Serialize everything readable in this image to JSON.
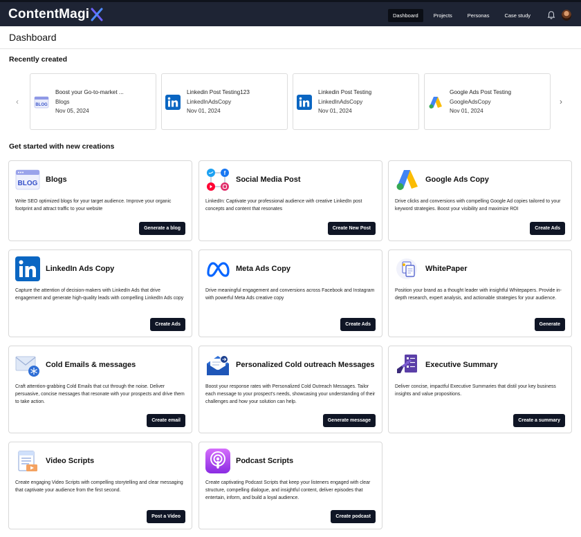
{
  "app": {
    "logo_text": "ContentMagi",
    "logo_mark": "X"
  },
  "nav": {
    "items": [
      {
        "label": "Dashboard",
        "active": true
      },
      {
        "label": "Projects",
        "active": false
      },
      {
        "label": "Personas",
        "active": false
      },
      {
        "label": "Case study",
        "active": false
      }
    ]
  },
  "page": {
    "title": "Dashboard"
  },
  "recent": {
    "title": "Recently created",
    "items": [
      {
        "icon": "blog-icon",
        "title": "Boost your Go-to-market ...",
        "type": "Blogs",
        "date": "Nov 05, 2024"
      },
      {
        "icon": "linkedin-icon",
        "title": "Linkedin Post Testing123",
        "type": "LinkedInAdsCopy",
        "date": "Nov 01, 2024"
      },
      {
        "icon": "linkedin-icon",
        "title": "Linkedin Post Testing",
        "type": "LinkedInAdsCopy",
        "date": "Nov 01, 2024"
      },
      {
        "icon": "google-ads-icon",
        "title": "Google Ads Post Testing",
        "type": "GoogleAdsCopy",
        "date": "Nov 01, 2024"
      }
    ]
  },
  "creations": {
    "title": "Get started with new creations",
    "cards": [
      {
        "icon": "blog-icon",
        "title": "Blogs",
        "description": "Write SEO optimized blogs for your target audience. Improve your organic footprint and attract traffic to your website",
        "button": "Generate a blog"
      },
      {
        "icon": "social-media-icon",
        "title": "Social Media Post",
        "description": "LinkedIn: Captivate your professional audience with creative LinkedIn post concepts and content that resonates",
        "button": "Create New Post"
      },
      {
        "icon": "google-ads-icon",
        "title": "Google Ads Copy",
        "description": "Drive clicks and conversions with compelling Google Ad copies tailored to your keyword strategies. Boost your visibility and maximize ROI",
        "button": "Create Ads"
      },
      {
        "icon": "linkedin-icon",
        "title": "LinkedIn Ads Copy",
        "description": "Capture the attention of decision-makers with LinkedIn Ads that drive engagement and generate high-quality leads with compelling LinkedIn Ads copy",
        "button": "Create Ads"
      },
      {
        "icon": "meta-icon",
        "title": "Meta Ads Copy",
        "description": "Drive meaningful engagement and conversions across Facebook and Instagram with powerful Meta Ads creative copy",
        "button": "Create Ads"
      },
      {
        "icon": "whitepaper-icon",
        "title": "WhitePaper",
        "description": "Position your brand as a thought leader with insightful Whitepapers. Provide in-depth research, expert analysis, and actionable strategies for your audience.",
        "button": "Generate"
      },
      {
        "icon": "email-icon",
        "title": "Cold Emails & messages",
        "description": "Craft attention-grabbing Cold Emails that cut through the noise. Deliver persuasive, concise messages that resonate with your prospects and drive them to take action.",
        "button": "Create email"
      },
      {
        "icon": "outreach-icon",
        "title": "Personalized Cold outreach Messages",
        "description": "Boost your response rates with Personalized Cold Outreach Messages. Tailor each message to your prospect's needs, showcasing your understanding of their challenges and how your solution can help.",
        "button": "Generate message"
      },
      {
        "icon": "executive-summary-icon",
        "title": "Executive Summary",
        "description": "Deliver concise, impactful Executive Summaries that distil your key business insights and value propositions.",
        "button": "Create a summary"
      },
      {
        "icon": "video-script-icon",
        "title": "Video Scripts",
        "description": "Create engaging Video Scripts with compelling storytelling and clear messaging that captivate your audience from the first second.",
        "button": "Post a Video"
      },
      {
        "icon": "podcast-icon",
        "title": "Podcast Scripts",
        "description": "Create captivating Podcast Scripts that keep your listeners engaged with clear structure, compelling dialogue, and insightful content, deliver episodes that entertain, inform, and build a loyal audience.",
        "button": "Create podcast"
      }
    ]
  },
  "colors": {
    "topbar": "#1e2434",
    "accent": "#6c63ff",
    "button": "#0f1525"
  }
}
